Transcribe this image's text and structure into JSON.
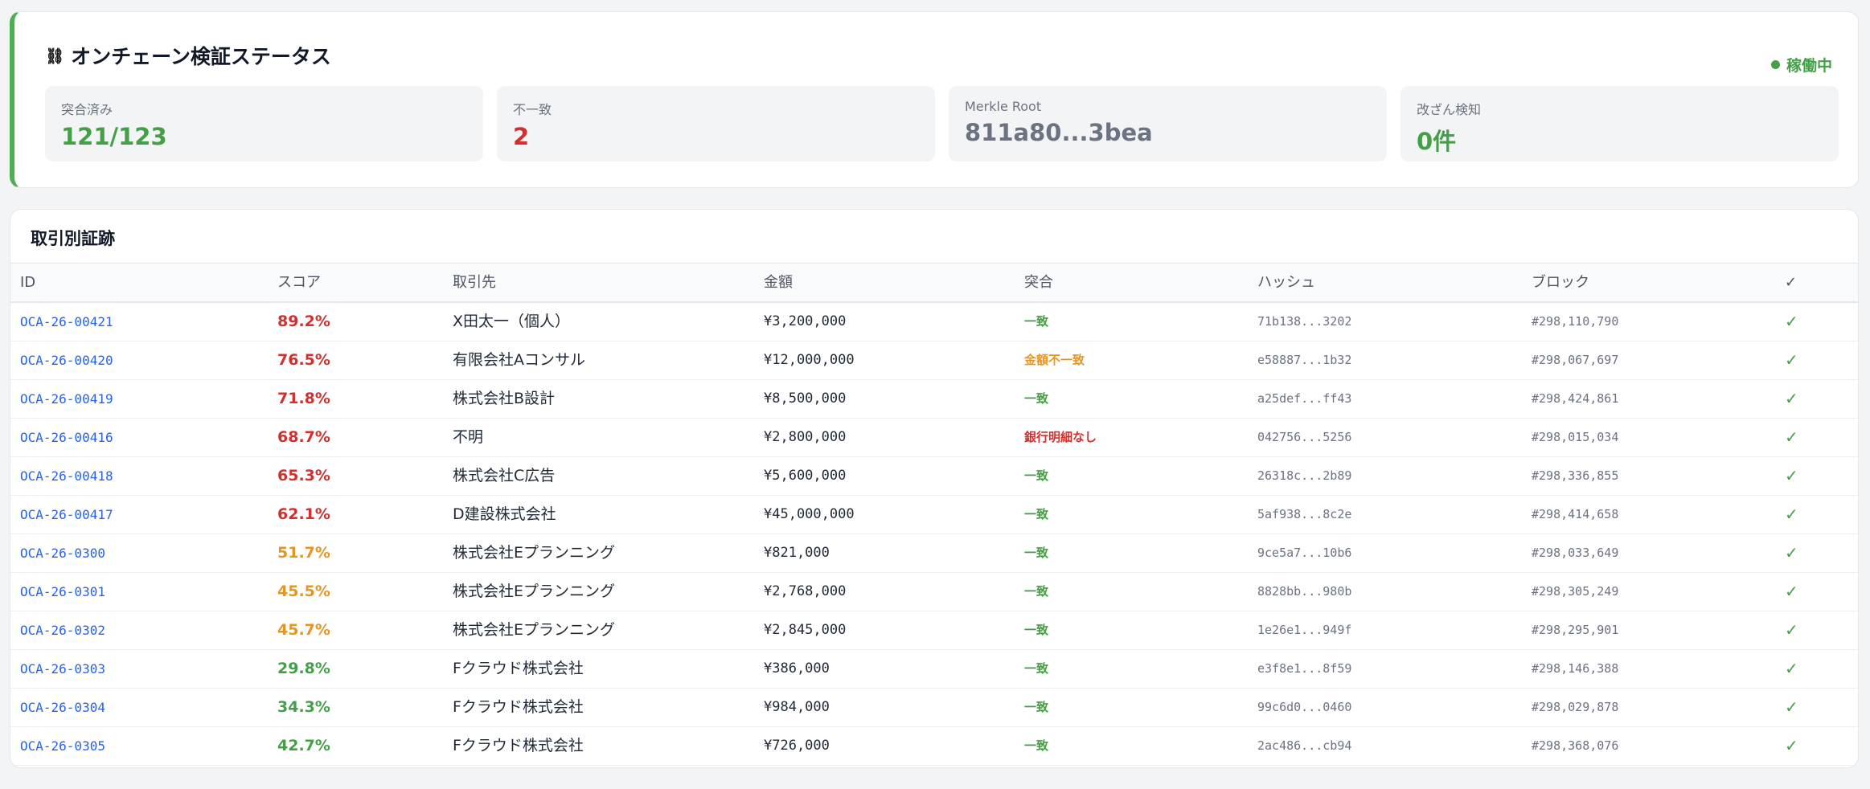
{
  "status": {
    "title_icon": "⛓",
    "title": "オンチェーン検証ステータス",
    "badge": "稼働中",
    "stats": [
      {
        "label": "突合済み",
        "value": "121/123",
        "color": "#43a047"
      },
      {
        "label": "不一致",
        "value": "2",
        "color": "#d32f2f"
      },
      {
        "label": "Merkle Root",
        "value": "811a80...3bea",
        "color": "#6b7280"
      },
      {
        "label": "改ざん検知",
        "value": "0件",
        "color": "#43a047"
      }
    ]
  },
  "table": {
    "title": "取引別証跡",
    "headers": [
      "ID",
      "スコア",
      "取引先",
      "金額",
      "突合",
      "ハッシュ",
      "ブロック",
      "✓"
    ],
    "rows": [
      {
        "id": "OCA-26-00421",
        "score": "89.2%",
        "score_level": "red",
        "partner": "X田太一（個人）",
        "amount": "¥3,200,000",
        "match": "一致",
        "match_level": "ok",
        "hash": "71b138...3202",
        "block": "#298,110,790",
        "check": "✓"
      },
      {
        "id": "OCA-26-00420",
        "score": "76.5%",
        "score_level": "red",
        "partner": "有限会社Aコンサル",
        "amount": "¥12,000,000",
        "match": "金額不一致",
        "match_level": "warn",
        "hash": "e58887...1b32",
        "block": "#298,067,697",
        "check": "✓"
      },
      {
        "id": "OCA-26-00419",
        "score": "71.8%",
        "score_level": "red",
        "partner": "株式会社B設計",
        "amount": "¥8,500,000",
        "match": "一致",
        "match_level": "ok",
        "hash": "a25def...ff43",
        "block": "#298,424,861",
        "check": "✓"
      },
      {
        "id": "OCA-26-00416",
        "score": "68.7%",
        "score_level": "red",
        "partner": "不明",
        "amount": "¥2,800,000",
        "match": "銀行明細なし",
        "match_level": "bad",
        "hash": "042756...5256",
        "block": "#298,015,034",
        "check": "✓"
      },
      {
        "id": "OCA-26-00418",
        "score": "65.3%",
        "score_level": "red",
        "partner": "株式会社C広告",
        "amount": "¥5,600,000",
        "match": "一致",
        "match_level": "ok",
        "hash": "26318c...2b89",
        "block": "#298,336,855",
        "check": "✓"
      },
      {
        "id": "OCA-26-00417",
        "score": "62.1%",
        "score_level": "red",
        "partner": "D建設株式会社",
        "amount": "¥45,000,000",
        "match": "一致",
        "match_level": "ok",
        "hash": "5af938...8c2e",
        "block": "#298,414,658",
        "check": "✓"
      },
      {
        "id": "OCA-26-0300",
        "score": "51.7%",
        "score_level": "orange",
        "partner": "株式会社Eプランニング",
        "amount": "¥821,000",
        "match": "一致",
        "match_level": "ok",
        "hash": "9ce5a7...10b6",
        "block": "#298,033,649",
        "check": "✓"
      },
      {
        "id": "OCA-26-0301",
        "score": "45.5%",
        "score_level": "orange",
        "partner": "株式会社Eプランニング",
        "amount": "¥2,768,000",
        "match": "一致",
        "match_level": "ok",
        "hash": "8828bb...980b",
        "block": "#298,305,249",
        "check": "✓"
      },
      {
        "id": "OCA-26-0302",
        "score": "45.7%",
        "score_level": "orange",
        "partner": "株式会社Eプランニング",
        "amount": "¥2,845,000",
        "match": "一致",
        "match_level": "ok",
        "hash": "1e26e1...949f",
        "block": "#298,295,901",
        "check": "✓"
      },
      {
        "id": "OCA-26-0303",
        "score": "29.8%",
        "score_level": "green",
        "partner": "Fクラウド株式会社",
        "amount": "¥386,000",
        "match": "一致",
        "match_level": "ok",
        "hash": "e3f8e1...8f59",
        "block": "#298,146,388",
        "check": "✓"
      },
      {
        "id": "OCA-26-0304",
        "score": "34.3%",
        "score_level": "green",
        "partner": "Fクラウド株式会社",
        "amount": "¥984,000",
        "match": "一致",
        "match_level": "ok",
        "hash": "99c6d0...0460",
        "block": "#298,029,878",
        "check": "✓"
      },
      {
        "id": "OCA-26-0305",
        "score": "42.7%",
        "score_level": "green",
        "partner": "Fクラウド株式会社",
        "amount": "¥726,000",
        "match": "一致",
        "match_level": "ok",
        "hash": "2ac486...cb94",
        "block": "#298,368,076",
        "check": "✓"
      }
    ]
  }
}
